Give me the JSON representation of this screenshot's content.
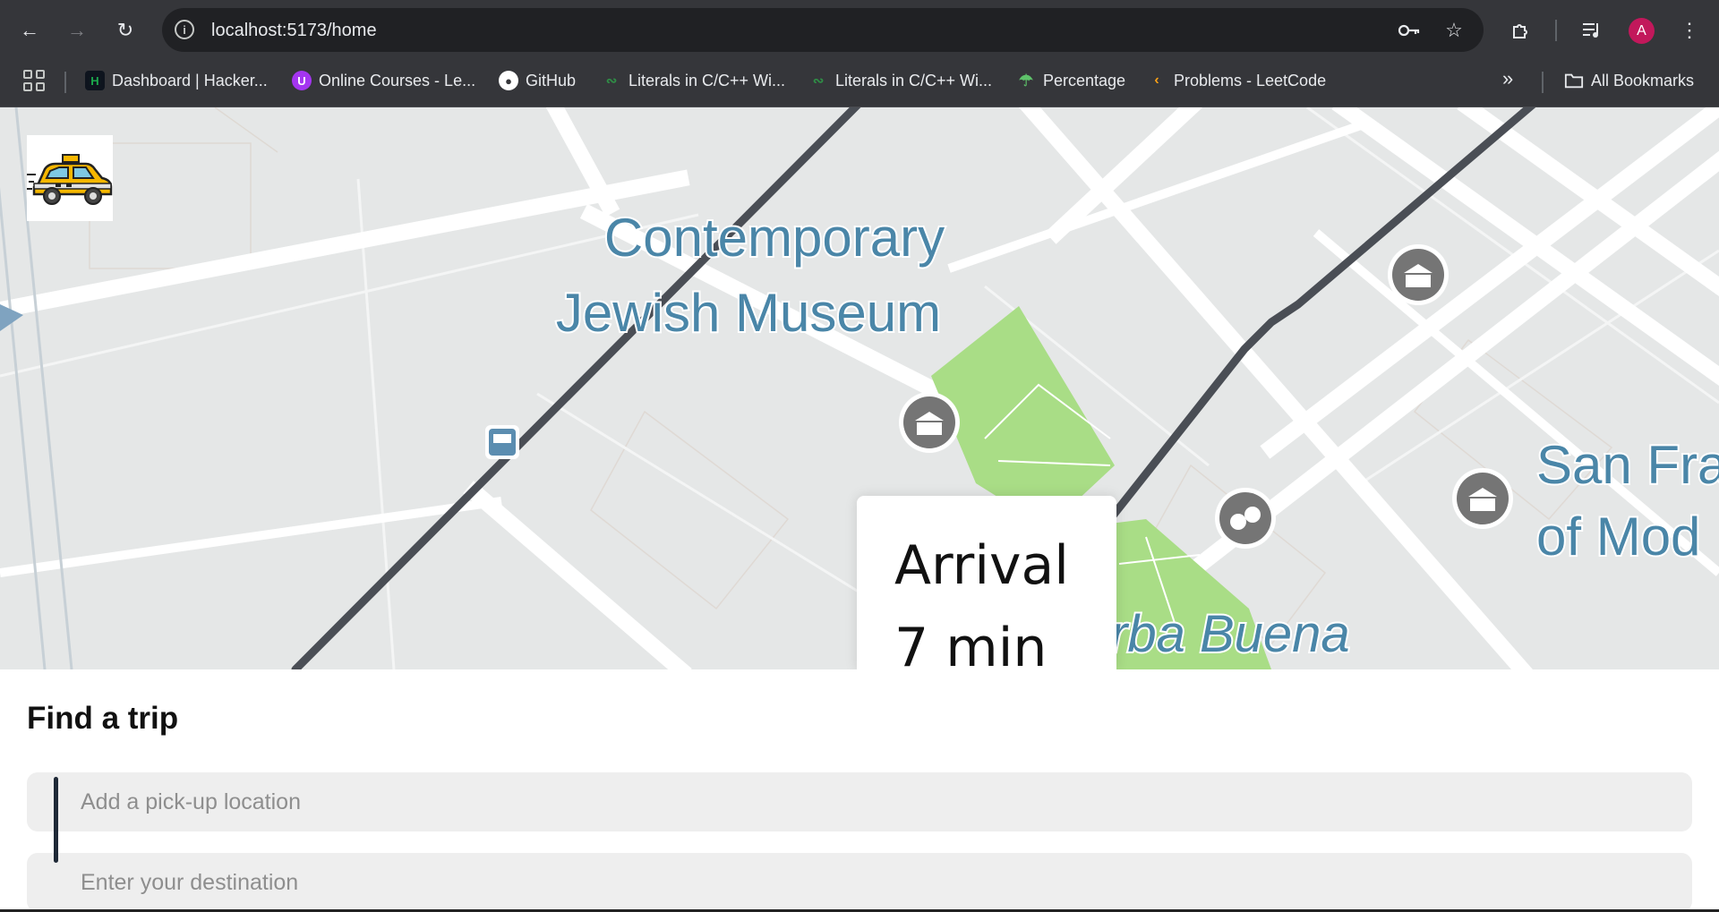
{
  "browser": {
    "url": "localhost:5173/home",
    "avatar_initial": "A",
    "icons": [
      "back-icon",
      "forward-icon",
      "reload-icon",
      "site-info-icon",
      "password-key-icon",
      "star-icon",
      "extensions-icon",
      "media-queue-icon",
      "more-menu-icon"
    ]
  },
  "bookmarks": {
    "items": [
      {
        "label": "Dashboard | Hacker...",
        "icon": "hackerrank-icon",
        "color": "#1ba94c"
      },
      {
        "label": "Online Courses - Le...",
        "icon": "udemy-icon",
        "color": "#a435f0"
      },
      {
        "label": "GitHub",
        "icon": "github-icon",
        "color": "#ffffff"
      },
      {
        "label": "Literals in C/C++ Wi...",
        "icon": "geeksforgeeks-icon",
        "color": "#2f8d46"
      },
      {
        "label": "Literals in C/C++ Wi...",
        "icon": "geeksforgeeks-icon",
        "color": "#2f8d46"
      },
      {
        "label": "Percentage",
        "icon": "percentage-icon",
        "color": "#2e7d32"
      },
      {
        "label": "Problems - LeetCode",
        "icon": "leetcode-icon",
        "color": "#ffa116"
      }
    ],
    "overflow_label": "»",
    "all_bookmarks_label": "All Bookmarks"
  },
  "map": {
    "labels": {
      "museum_line1": "Contemporary",
      "museum_line2": "Jewish Museum",
      "sfmoma_line1": "San Fra",
      "sfmoma_line2": "of Mod",
      "park": "rba Buena"
    },
    "colors": {
      "background": "#e5e7e7",
      "road": "#ffffff",
      "route": "#4a4e55",
      "park": "#a9dd86",
      "label": "#4a86a8",
      "poi": "#757575"
    }
  },
  "arrival": {
    "line1": "Arrival",
    "line2": "7 min"
  },
  "trip": {
    "title": "Find a trip",
    "pickup_placeholder": "Add a pick-up location",
    "destination_placeholder": "Enter your destination"
  }
}
